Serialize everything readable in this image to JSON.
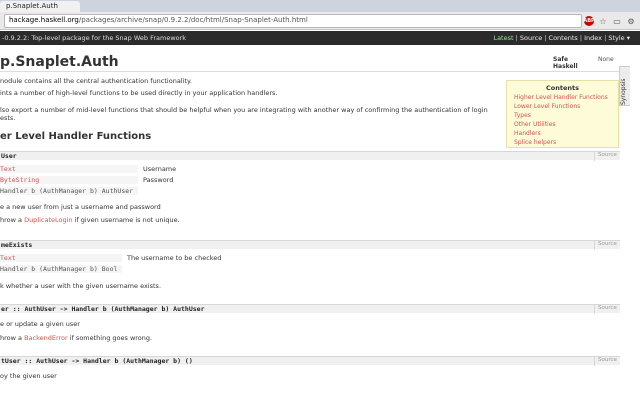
{
  "browser": {
    "tab_title": "p.Snaplet.Auth",
    "url_host": "hackage.haskell.org",
    "url_path": "/packages/archive/snap/0.9.2.2/doc/html/Snap-Snaplet-Auth.html",
    "abp_label": "ABP"
  },
  "pkg_bar": {
    "title": "-0.9.2.2: Top-level package for the Snap Web Framework",
    "links": [
      "Latest",
      "Source",
      "Contents",
      "Index",
      "Style ▾"
    ]
  },
  "module": {
    "title": "p.Snaplet.Auth",
    "info": [
      {
        "key": "Safe Haskell",
        "value": "None"
      }
    ],
    "description": [
      "nodule contains all the central authentication functionality.",
      "ints a number of high-level functions to be used directly in your application handlers.",
      "lso export a number of mid-level functions that should be helpful when you are integrating with another way of confirming the authentication of login",
      "ests."
    ]
  },
  "synopsis_label": "Synopsis",
  "contents": {
    "title": "Contents",
    "items": [
      "Higher Level Handler Functions",
      "Lower Level Functions",
      "Types",
      "Other Utilities",
      "Handlers",
      "Splice helpers"
    ]
  },
  "section_title": "er Level Handler Functions",
  "source_label": "Source",
  "decls": [
    {
      "sig": "User",
      "args": [
        {
          "type": "Text",
          "desc": "Username"
        },
        {
          "type": "ByteString",
          "desc": "Password"
        },
        {
          "type": "Handler b (AuthManager b) AuthUser",
          "desc": ""
        }
      ],
      "paras": [
        {
          "pre": "e a new user from just a username and password",
          "link": "",
          "post": ""
        },
        {
          "pre": "hrow a ",
          "link": "DuplicateLogin",
          "post": " if given username is not unique."
        }
      ]
    },
    {
      "sig": "meExists",
      "args": [
        {
          "type": "Text",
          "desc": "The username to be checked"
        },
        {
          "type": "Handler b (AuthManager b) Bool",
          "desc": ""
        }
      ],
      "paras": [
        {
          "pre": "k whether a user with the given username exists.",
          "link": "",
          "post": ""
        }
      ]
    },
    {
      "sig": "er :: AuthUser -> Handler b (AuthManager b) AuthUser",
      "args": [],
      "paras": [
        {
          "pre": "e or update a given user",
          "link": "",
          "post": ""
        },
        {
          "pre": "hrow a ",
          "link": "BackendError",
          "post": " if something goes wrong."
        }
      ]
    },
    {
      "sig": "tUser :: AuthUser -> Handler b (AuthManager b) ()",
      "args": [],
      "paras": [
        {
          "pre": "oy the given user",
          "link": "",
          "post": ""
        }
      ]
    }
  ]
}
